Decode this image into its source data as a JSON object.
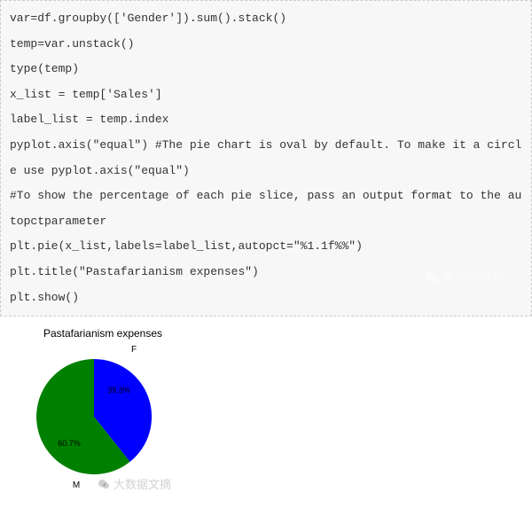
{
  "code": {
    "l1": "var=df.groupby(['Gender']).sum().stack()",
    "l2": "temp=var.unstack()",
    "l3": "type(temp)",
    "l4": "x_list = temp['Sales']",
    "l5": "label_list = temp.index",
    "l6": "pyplot.axis(\"equal\") #The pie chart is oval by default. To make it a circle use pyplot.axis(\"equal\")",
    "l7": "#To show the percentage of each pie slice, pass an output format to the autopctparameter",
    "l8": "plt.pie(x_list,labels=label_list,autopct=\"%1.1f%%\")",
    "l9": "plt.title(\"Pastafarianism expenses\")",
    "l10": "plt.show()"
  },
  "watermark": "大数据文摘",
  "chart_data": {
    "type": "pie",
    "title": "Pastafarianism expenses",
    "series": [
      {
        "name": "F",
        "value": 39.3,
        "color": "#0000ff"
      },
      {
        "name": "M",
        "value": 60.7,
        "color": "#008000"
      }
    ]
  },
  "slice_labels": {
    "f": "F",
    "m": "M"
  },
  "pct_labels": {
    "f": "39.3%",
    "m": "60.7%"
  }
}
